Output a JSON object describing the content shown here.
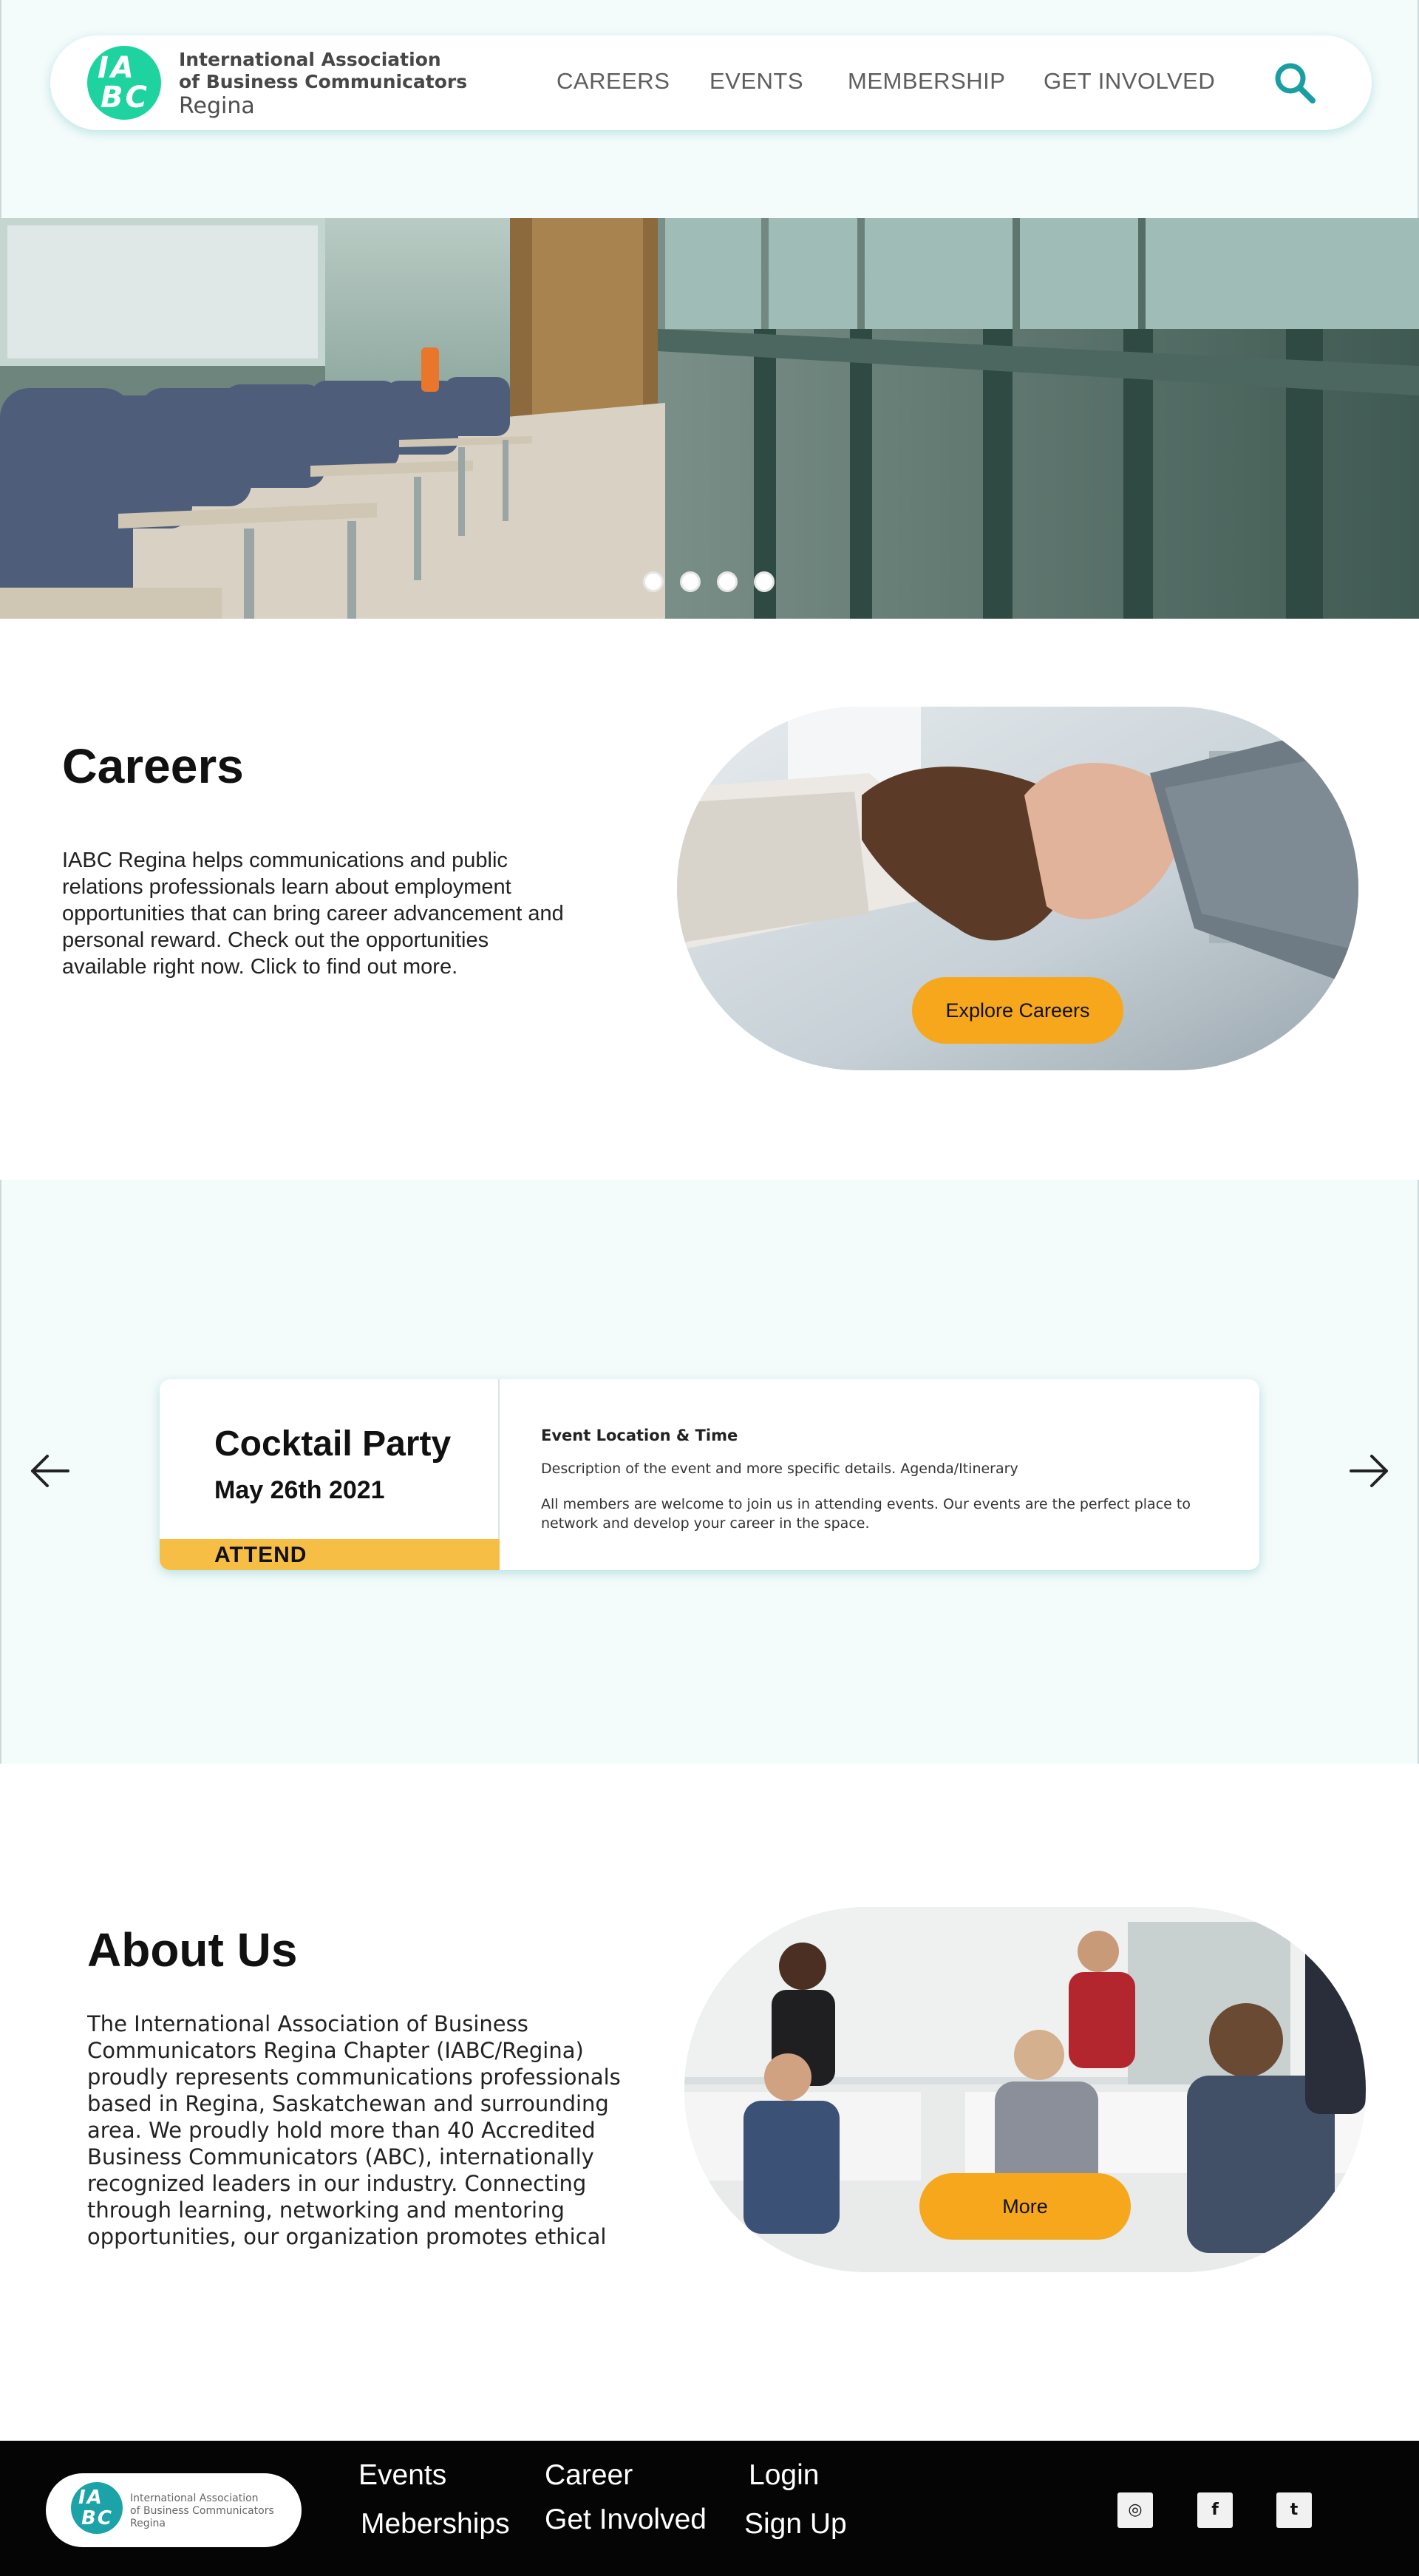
{
  "header": {
    "logo": {
      "initials_top": "IA",
      "initials_bottom": "BC",
      "line1": "International Association",
      "line2": "of Business Communicators",
      "line3": "Regina"
    },
    "nav": [
      "CAREERS",
      "EVENTS",
      "MEMBERSHIP",
      "GET INVOLVED"
    ],
    "search_icon": "search-icon"
  },
  "hero": {
    "slide_count": 4,
    "active_slide": 1
  },
  "careers": {
    "title": "Careers",
    "text": "IABC Regina helps communications and public relations professionals learn about employment opportunities that can bring career advancement and personal reward. Check out the opportunities available right now. Click to find out more.",
    "button": "Explore Careers"
  },
  "event": {
    "title": "Cocktail Party",
    "date": "May 26th 2021",
    "attend": "ATTEND",
    "location": "Event Location & Time",
    "description": "Description of the event and more specific details. Agenda/Itinerary",
    "note": "All members are welcome to join us in attending events. Our events are the perfect place to network and develop your career in the space."
  },
  "about": {
    "title": "About Us",
    "text": "The International Association of Business Communicators Regina Chapter (IABC/Regina) proudly represents communications professionals based in Regina, Saskatchewan and surrounding area. We proudly hold more than 40 Accredited Business Communicators (ABC), internationally recognized leaders in our industry. Connecting through learning, networking and mentoring opportunities, our organization promotes ethical",
    "button": "More"
  },
  "footer": {
    "logo": {
      "initials_top": "IA",
      "initials_bottom": "BC",
      "line1": "International Association",
      "line2": "of Business Communicators",
      "line3": "Regina"
    },
    "links": {
      "events": "Events",
      "career": "Career",
      "login": "Login",
      "memberships": "Meberships",
      "get_involved": "Get Involved",
      "sign_up": "Sign Up"
    },
    "social": {
      "instagram": "◎",
      "facebook": "f",
      "twitter": "t"
    }
  },
  "colors": {
    "accent": "#f6a71b",
    "brand": "#1fd3a0",
    "teal": "#1a9ea3",
    "band": "#f4fbfb"
  }
}
